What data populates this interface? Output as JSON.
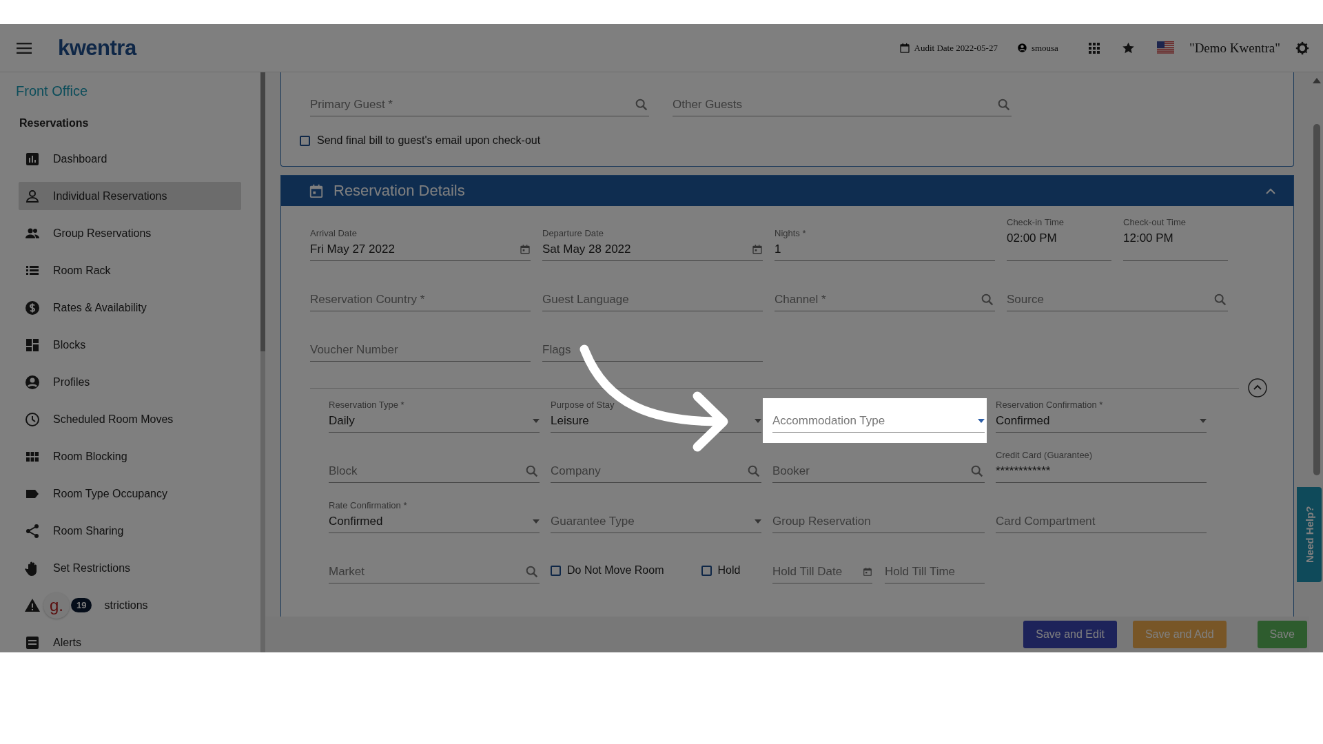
{
  "header": {
    "logo": "kwentra",
    "audit_date": "Audit Date 2022-05-27",
    "user": "smousa",
    "property": "\"Demo Kwentra\""
  },
  "sidebar": {
    "title": "Front Office",
    "section": "Reservations",
    "items": [
      {
        "label": "Dashboard",
        "selected": false
      },
      {
        "label": "Individual Reservations",
        "selected": true
      },
      {
        "label": "Group Reservations",
        "selected": false
      },
      {
        "label": "Room Rack",
        "selected": false
      },
      {
        "label": "Rates & Availability",
        "selected": false
      },
      {
        "label": "Blocks",
        "selected": false
      },
      {
        "label": "Profiles",
        "selected": false
      },
      {
        "label": "Scheduled Room Moves",
        "selected": false
      },
      {
        "label": "Room Blocking",
        "selected": false
      },
      {
        "label": "Room Type Occupancy",
        "selected": false
      },
      {
        "label": "Room Sharing",
        "selected": false
      },
      {
        "label": "Set Restrictions",
        "selected": false
      },
      {
        "label": "strictions",
        "selected": false,
        "widget": {
          "letter": "g.",
          "count": "19"
        }
      },
      {
        "label": "Alerts",
        "selected": false
      }
    ]
  },
  "guests": {
    "fields": [
      {
        "kind": "search",
        "placeholder": "Primary Guest *"
      },
      {
        "kind": "search",
        "placeholder": "Other Guests"
      }
    ],
    "email_bill": {
      "label": "Send final bill to guest's email upon check-out",
      "checked": false
    }
  },
  "details": {
    "title": "Reservation Details",
    "expanded": true,
    "rows": [
      [
        {
          "kind": "date",
          "label": "Arrival Date",
          "value": "Fri May 27 2022"
        },
        {
          "kind": "date",
          "label": "Departure Date",
          "value": "Sat May 28 2022"
        },
        {
          "kind": "text",
          "label": "Nights *",
          "value": "1"
        },
        {
          "kind": "time",
          "label": "Check-in Time",
          "value": "02:00 PM"
        },
        {
          "kind": "time",
          "label": "Check-out Time",
          "value": "12:00 PM"
        }
      ],
      [
        {
          "kind": "text",
          "placeholder": "Reservation Country *"
        },
        {
          "kind": "text",
          "placeholder": "Guest Language"
        },
        {
          "kind": "search",
          "placeholder": "Channel *"
        },
        {
          "kind": "search",
          "placeholder": "Source"
        }
      ],
      [
        {
          "kind": "text",
          "placeholder": "Voucher Number"
        },
        {
          "kind": "text",
          "placeholder": "Flags"
        }
      ]
    ],
    "sub_rows": [
      [
        {
          "kind": "select",
          "label": "Reservation Type *",
          "value": "Daily"
        },
        {
          "kind": "select",
          "label": "Purpose of Stay",
          "value": "Leisure"
        },
        {
          "kind": "select",
          "placeholder": "Accommodation Type",
          "highlighted": true
        },
        {
          "kind": "select",
          "label": "Reservation Confirmation *",
          "value": "Confirmed"
        }
      ],
      [
        {
          "kind": "search",
          "placeholder": "Block"
        },
        {
          "kind": "search",
          "placeholder": "Company"
        },
        {
          "kind": "search",
          "placeholder": "Booker"
        },
        {
          "kind": "text",
          "label": "Credit Card (Guarantee)",
          "value": "************"
        }
      ],
      [
        {
          "kind": "select",
          "label": "Rate Confirmation *",
          "value": "Confirmed"
        },
        {
          "kind": "select",
          "placeholder": "Guarantee Type"
        },
        {
          "kind": "text",
          "placeholder": "Group Reservation"
        },
        {
          "kind": "text",
          "placeholder": "Card Compartment"
        }
      ],
      [
        {
          "kind": "search",
          "placeholder": "Market"
        },
        {
          "kind": "group",
          "items": [
            {
              "kind": "checkbox",
              "label": "Do Not Move Room",
              "checked": false
            },
            {
              "kind": "checkbox",
              "label": "Hold",
              "checked": false
            }
          ]
        },
        {
          "kind": "group",
          "items": [
            {
              "kind": "date",
              "placeholder": "Hold Till Date"
            },
            {
              "kind": "text",
              "placeholder": "Hold Till Time"
            }
          ]
        }
      ]
    ]
  },
  "footer": {
    "buttons": [
      {
        "label": "Save and Edit",
        "kind": "primary"
      },
      {
        "label": "Save and Add",
        "kind": "warning"
      },
      {
        "label": "Save",
        "kind": "success"
      }
    ]
  },
  "help_tab": "Need Help?"
}
